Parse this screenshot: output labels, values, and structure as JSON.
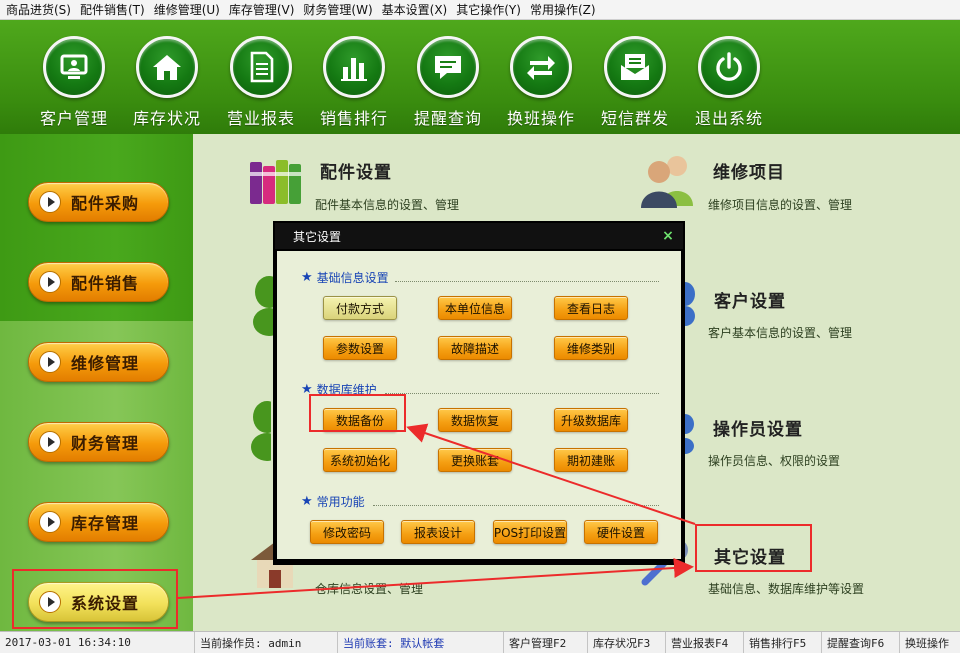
{
  "menubar": [
    "商品进货(S)",
    "配件销售(T)",
    "维修管理(U)",
    "库存管理(V)",
    "财务管理(W)",
    "基本设置(X)",
    "其它操作(Y)",
    "常用操作(Z)"
  ],
  "toolbar": [
    {
      "label": "客户管理",
      "icon": "monitor-icon"
    },
    {
      "label": "库存状况",
      "icon": "home-icon"
    },
    {
      "label": "营业报表",
      "icon": "document-icon"
    },
    {
      "label": "销售排行",
      "icon": "bar-chart-icon"
    },
    {
      "label": "提醒查询",
      "icon": "speech-bubble-icon"
    },
    {
      "label": "换班操作",
      "icon": "swap-arrows-icon"
    },
    {
      "label": "短信群发",
      "icon": "envelope-icon"
    },
    {
      "label": "退出系统",
      "icon": "power-icon"
    }
  ],
  "sidebar": [
    {
      "label": "配件采购",
      "active": false
    },
    {
      "label": "配件销售",
      "active": false
    },
    {
      "label": "维修管理",
      "active": false
    },
    {
      "label": "财务管理",
      "active": false
    },
    {
      "label": "库存管理",
      "active": false
    },
    {
      "label": "系统设置",
      "active": true
    }
  ],
  "main": {
    "parts_settings": {
      "title": "配件设置",
      "desc": "配件基本信息的设置、管理"
    },
    "repair_items": {
      "title": "维修项目",
      "desc": "维修项目信息的设置、管理"
    },
    "customer_settings": {
      "title": "客户设置",
      "desc": "客户基本信息的设置、管理"
    },
    "operator_settings": {
      "title": "操作员设置",
      "desc": "操作员信息、权限的设置"
    },
    "other_settings": {
      "title": "其它设置",
      "desc": "基础信息、数据库维护等设置"
    },
    "warehouse_desc": "仓库信息设置、管理"
  },
  "dialog": {
    "title": "其它设置",
    "close": "×",
    "sections": [
      {
        "title": "基础信息设置",
        "buttons": [
          "付款方式",
          "本单位信息",
          "查看日志",
          "参数设置",
          "故障描述",
          "维修类别"
        ]
      },
      {
        "title": "数据库维护",
        "buttons": [
          "数据备份",
          "数据恢复",
          "升级数据库",
          "系统初始化",
          "更换账套",
          "期初建账"
        ]
      },
      {
        "title": "常用功能",
        "buttons": [
          "修改密码",
          "报表设计",
          "POS打印设置",
          "硬件设置"
        ]
      }
    ]
  },
  "statusbar": {
    "datetime": "2017-03-01 16:34:10",
    "operator": "当前操作员: admin",
    "account": "当前账套: 默认帐套",
    "shortcuts": [
      "客户管理F2",
      "库存状况F3",
      "营业报表F4",
      "销售排行F5",
      "提醒查询F6",
      "换班操作"
    ]
  },
  "colors": {
    "toolbar_green": "#3a8d0f",
    "button_orange": "#f59a0a",
    "annotation_red": "#ec2b2b",
    "section_blue": "#1844b5"
  }
}
